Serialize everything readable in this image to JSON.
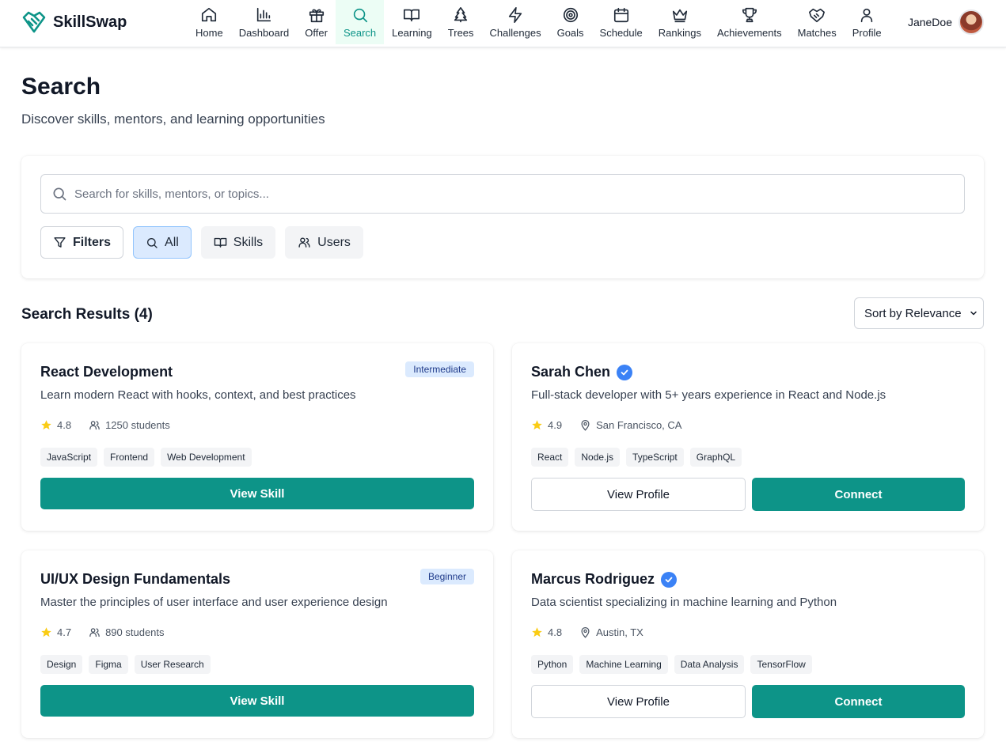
{
  "brand": {
    "name": "SkillSwap",
    "accent": "#0d9488"
  },
  "nav": [
    {
      "label": "Home",
      "icon": "home-icon"
    },
    {
      "label": "Dashboard",
      "icon": "bar-chart-icon"
    },
    {
      "label": "Offer",
      "icon": "gift-icon"
    },
    {
      "label": "Search",
      "icon": "search-icon",
      "active": true
    },
    {
      "label": "Learning",
      "icon": "book-icon"
    },
    {
      "label": "Trees",
      "icon": "tree-icon"
    },
    {
      "label": "Challenges",
      "icon": "lightning-icon"
    },
    {
      "label": "Goals",
      "icon": "target-icon"
    },
    {
      "label": "Schedule",
      "icon": "calendar-icon"
    },
    {
      "label": "Rankings",
      "icon": "crown-icon"
    },
    {
      "label": "Achievements",
      "icon": "trophy-icon"
    },
    {
      "label": "Matches",
      "icon": "handshake-icon"
    },
    {
      "label": "Profile",
      "icon": "user-icon"
    }
  ],
  "user": {
    "name": "JaneDoe"
  },
  "page": {
    "title": "Search",
    "subtitle": "Discover skills, mentors, and learning opportunities"
  },
  "search": {
    "placeholder": "Search for skills, mentors, or topics...",
    "value": "",
    "filters_label": "Filters",
    "chips": [
      "All",
      "Skills",
      "Users"
    ]
  },
  "results": {
    "heading": "Search Results (4)",
    "sort_label": "Sort by Relevance"
  },
  "cards": [
    {
      "type": "skill",
      "title": "React Development",
      "level": "Intermediate",
      "description": "Learn modern React with hooks, context, and best practices",
      "rating": "4.8",
      "students": "1250 students",
      "tags": [
        "JavaScript",
        "Frontend",
        "Web Development"
      ],
      "button": "View Skill"
    },
    {
      "type": "user",
      "title": "Sarah Chen",
      "description": "Full-stack developer with 5+ years experience in React and Node.js",
      "rating": "4.9",
      "location": "San Francisco, CA",
      "tags": [
        "React",
        "Node.js",
        "TypeScript",
        "GraphQL"
      ],
      "button_profile": "View Profile",
      "button_connect": "Connect"
    },
    {
      "type": "skill",
      "title": "UI/UX Design Fundamentals",
      "level": "Beginner",
      "description": "Master the principles of user interface and user experience design",
      "rating": "4.7",
      "students": "890 students",
      "tags": [
        "Design",
        "Figma",
        "User Research"
      ],
      "button": "View Skill"
    },
    {
      "type": "user",
      "title": "Marcus Rodriguez",
      "description": "Data scientist specializing in machine learning and Python",
      "rating": "4.8",
      "location": "Austin, TX",
      "tags": [
        "Python",
        "Machine Learning",
        "Data Analysis",
        "TensorFlow"
      ],
      "button_profile": "View Profile",
      "button_connect": "Connect"
    }
  ]
}
